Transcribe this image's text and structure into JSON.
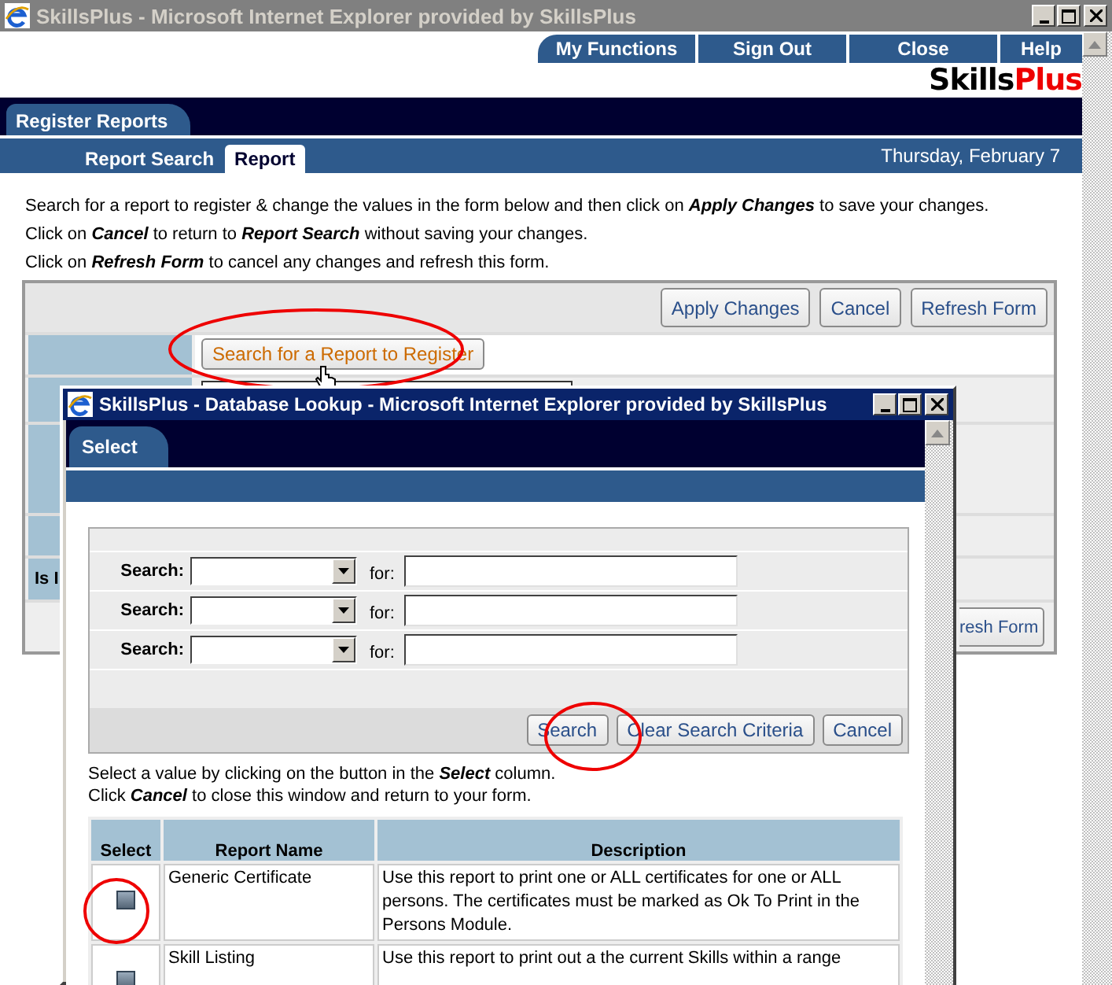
{
  "window": {
    "title": "SkillsPlus - Microsoft Internet Explorer provided by SkillsPlus"
  },
  "nav": [
    {
      "label": "My Functions"
    },
    {
      "label": "Sign Out"
    },
    {
      "label": "Close"
    },
    {
      "label": "Help"
    }
  ],
  "logo": {
    "first": "Skills",
    "second": "Plus"
  },
  "section_tab": "Register Reports",
  "subtabs": [
    {
      "label": "Report Search",
      "selected": false
    },
    {
      "label": "Report",
      "selected": true
    }
  ],
  "date": "Thursday, February 7",
  "instructions": [
    "Search for a report to register & change the values in the form below and then click on **Apply Changes** to save your changes.",
    "Click on **Cancel** to return to **Report Search** without saving your changes.",
    "Click on **Refresh Form** to cancel any changes and refresh this form."
  ],
  "form": {
    "buttons": [
      "Apply Changes",
      "Cancel",
      "Refresh Form"
    ],
    "search_button": "Search for a Report to Register",
    "row_label": "Is I",
    "partial_button": "resh Form"
  },
  "popup": {
    "title": "SkillsPlus - Database Lookup - Microsoft Internet Explorer provided by SkillsPlus",
    "tab": "Select",
    "search_rows": [
      {
        "label": "Search:",
        "for": "for:"
      },
      {
        "label": "Search:",
        "for": "for:"
      },
      {
        "label": "Search:",
        "for": "for:"
      }
    ],
    "buttons": [
      "Search",
      "Clear Search Criteria",
      "Cancel"
    ],
    "instructions": [
      "Select a value by clicking on the button in the **Select** column.",
      "Click **Cancel** to close this window and return to your form."
    ],
    "table": {
      "columns": [
        "Select",
        "Report Name",
        "Description"
      ],
      "rows": [
        {
          "name": "Generic Certificate",
          "description": "Use this report to print one or ALL certificates for one or ALL persons. The certificates must be marked as Ok To Print in the Persons Module."
        },
        {
          "name": "Skill Listing",
          "description": "Use this report to print out a the current Skills within a range"
        }
      ]
    }
  }
}
